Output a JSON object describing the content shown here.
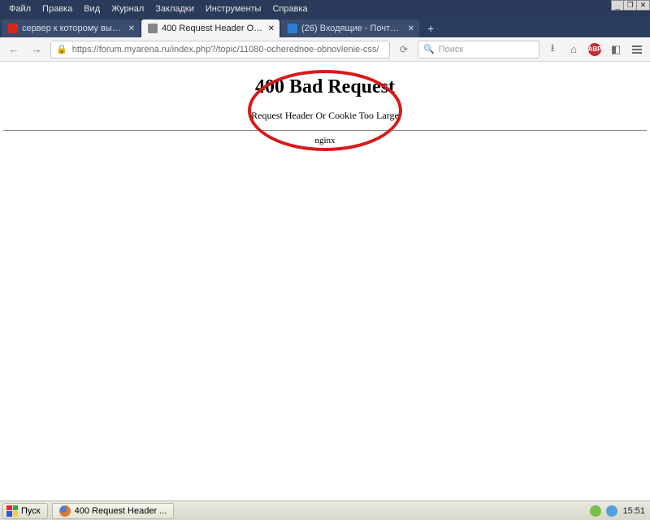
{
  "menubar": {
    "items": [
      "Файл",
      "Правка",
      "Вид",
      "Журнал",
      "Закладки",
      "Инструменты",
      "Справка"
    ]
  },
  "tabs": [
    {
      "label": "сервер к которому вы пыта...",
      "fav_color": "#d9261c",
      "active": false
    },
    {
      "label": "400 Request Header Or Cooki...",
      "fav_color": "#5a5a5a",
      "active": true
    },
    {
      "label": "(26) Входящие - Почта Mail...",
      "fav_color": "#2a7fd4",
      "active": false
    }
  ],
  "url": {
    "value": "https://forum.myarena.ru/index.php?/topic/11080-ocherednoe-obnovlenie-css/"
  },
  "search": {
    "placeholder": "Поиск"
  },
  "toolbar": {
    "abp_label": "ABP"
  },
  "error": {
    "title": "400 Bad Request",
    "subtitle": "Request Header Or Cookie Too Large",
    "server": "nginx"
  },
  "taskbar": {
    "start_label": "Пуск",
    "app_label": "400 Request Header ...",
    "clock": "15:51"
  },
  "annotation": {
    "ellipse_color": "#d61a1a"
  }
}
